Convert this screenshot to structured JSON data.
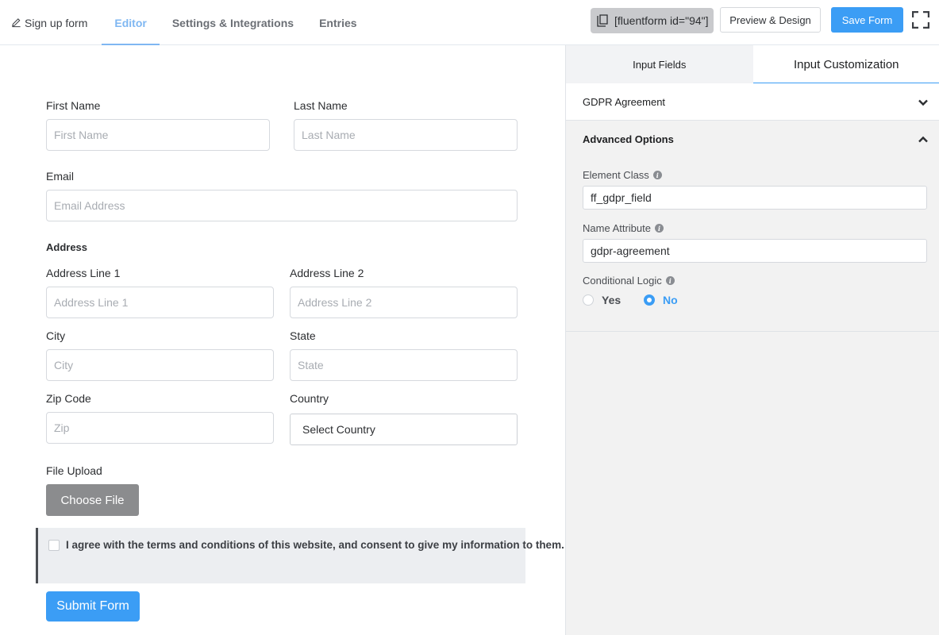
{
  "nav": {
    "form_title": "Sign up form",
    "tabs": [
      {
        "label": "Editor",
        "active": true
      },
      {
        "label": "Settings & Integrations",
        "active": false
      },
      {
        "label": "Entries",
        "active": false
      }
    ]
  },
  "toolbar": {
    "shortcode": "[fluentform id=\"94\"]",
    "preview_label": "Preview & Design",
    "save_label": "Save Form",
    "fullscreen_icon": "fullscreen-icon"
  },
  "form": {
    "first_name": {
      "label": "First Name",
      "placeholder": "First Name"
    },
    "last_name": {
      "label": "Last Name",
      "placeholder": "Last Name"
    },
    "email": {
      "label": "Email",
      "placeholder": "Email Address"
    },
    "address": {
      "label": "Address",
      "line1": {
        "label": "Address Line 1",
        "placeholder": "Address Line 1"
      },
      "line2": {
        "label": "Address Line 2",
        "placeholder": "Address Line 2"
      },
      "city": {
        "label": "City",
        "placeholder": "City"
      },
      "state": {
        "label": "State",
        "placeholder": "State"
      },
      "zip": {
        "label": "Zip Code",
        "placeholder": "Zip"
      },
      "country": {
        "label": "Country",
        "value": "Select Country"
      }
    },
    "file_upload": {
      "label": "File Upload",
      "button": "Choose File"
    },
    "gdpr_text": "I agree with the terms and conditions of this website, and consent to give my information to them.",
    "submit_label": "Submit Form"
  },
  "panel": {
    "tabs": [
      {
        "label": "Input Fields",
        "active": false
      },
      {
        "label": "Input Customization",
        "active": true
      }
    ],
    "sections": {
      "gdpr": "GDPR Agreement",
      "advanced": "Advanced Options"
    },
    "element_class": {
      "label": "Element Class",
      "value": "ff_gdpr_field"
    },
    "name_attribute": {
      "label": "Name Attribute",
      "value": "gdpr-agreement"
    },
    "conditional_logic": {
      "label": "Conditional Logic",
      "options": [
        {
          "label": "Yes",
          "checked": false
        },
        {
          "label": "No",
          "checked": true
        }
      ]
    }
  },
  "colors": {
    "accent": "#3b9df5",
    "active_tab": "#7fb7f2",
    "choose_file_bg": "#8b8c8e"
  }
}
